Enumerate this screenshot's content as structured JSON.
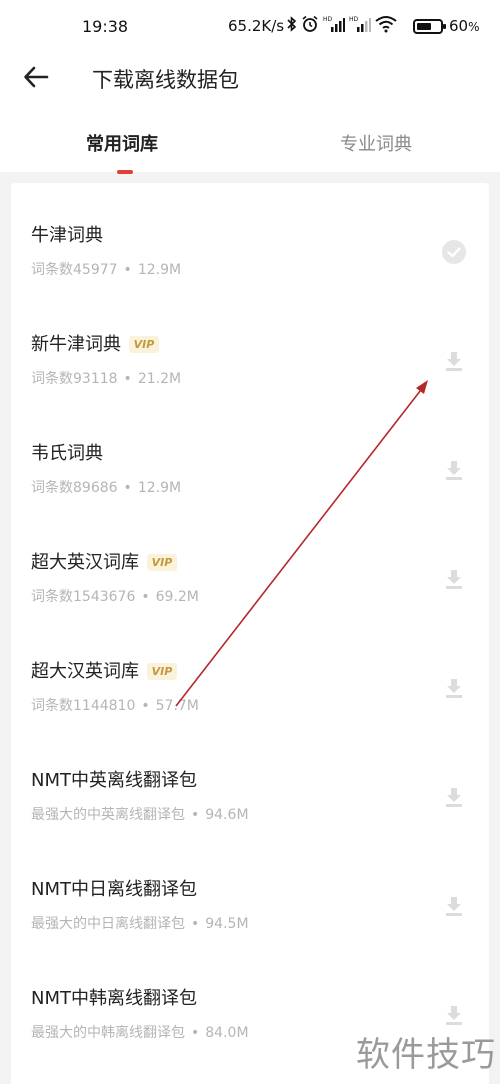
{
  "status_bar": {
    "time": "19:38",
    "speed": "65.2K/s",
    "battery_percent": "60"
  },
  "header": {
    "title": "下载离线数据包"
  },
  "tabs": [
    {
      "label": "常用词库",
      "active": true
    },
    {
      "label": "专业词典",
      "active": false
    }
  ],
  "items": [
    {
      "name": "牛津词典",
      "vip": "",
      "count": "词条数45977",
      "size": "12.9M",
      "status": "downloaded",
      "icon": "check-icon"
    },
    {
      "name": "新牛津词典",
      "vip": "VIP",
      "count": "词条数93118",
      "size": "21.2M",
      "status": "download",
      "icon": "download-icon"
    },
    {
      "name": "韦氏词典",
      "vip": "",
      "count": "词条数89686",
      "size": "12.9M",
      "status": "download",
      "icon": "download-icon"
    },
    {
      "name": "超大英汉词库",
      "vip": "VIP",
      "count": "词条数1543676",
      "size": "69.2M",
      "status": "download",
      "icon": "download-icon"
    },
    {
      "name": "超大汉英词库",
      "vip": "VIP",
      "count": "词条数1144810",
      "size": "57.7M",
      "status": "download",
      "icon": "download-icon"
    },
    {
      "name": "NMT中英离线翻译包",
      "vip": "",
      "count": "最强大的中英离线翻译包",
      "size": "94.6M",
      "status": "download",
      "icon": "download-icon"
    },
    {
      "name": "NMT中日离线翻译包",
      "vip": "",
      "count": "最强大的中日离线翻译包",
      "size": "94.5M",
      "status": "download",
      "icon": "download-icon"
    },
    {
      "name": "NMT中韩离线翻译包",
      "vip": "",
      "count": "最强大的中韩离线翻译包",
      "size": "84.0M",
      "status": "download",
      "icon": "download-icon"
    }
  ],
  "separator": "•",
  "watermark": "软件技巧",
  "colors": {
    "accent": "#e0403a",
    "vip_text": "#c39a3c",
    "vip_bg": "#fbf2dc",
    "arrow": "#b5282a"
  }
}
